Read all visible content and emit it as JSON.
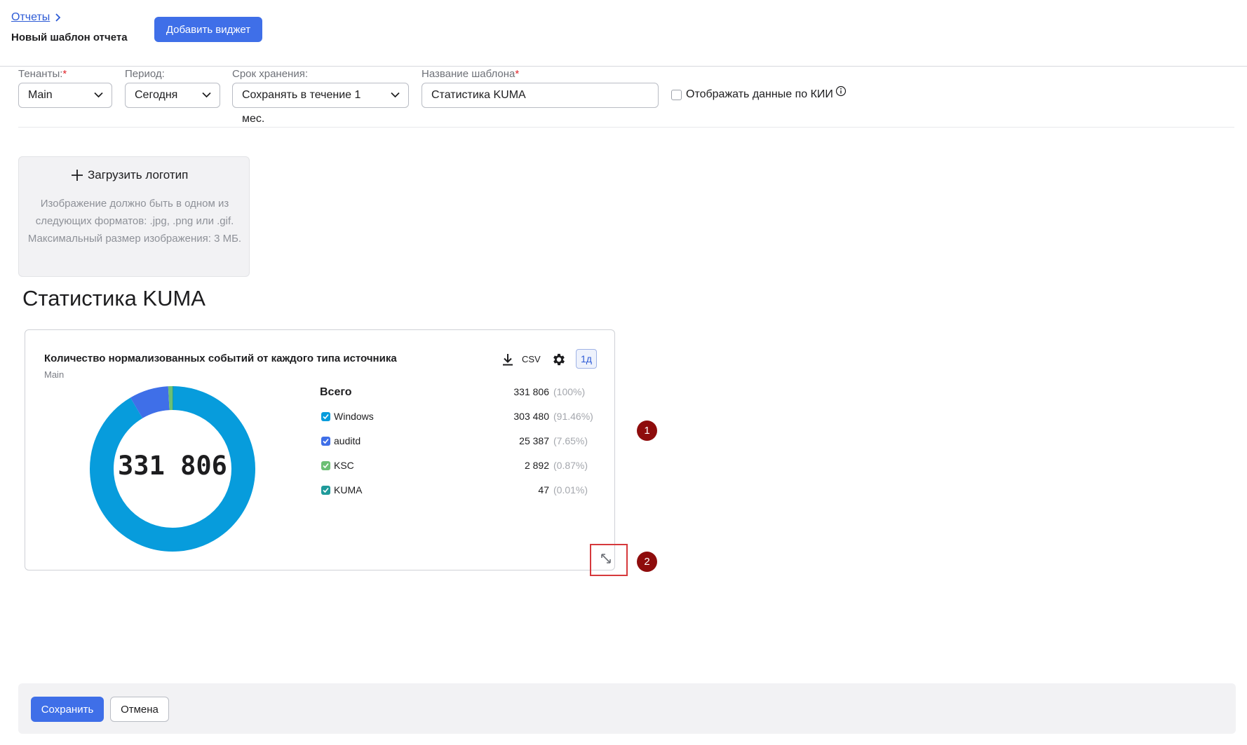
{
  "breadcrumb": {
    "parent": "Отчеты"
  },
  "page_title": "Новый шаблон отчета",
  "toolbar": {
    "add_widget": "Добавить виджет"
  },
  "filters": {
    "tenants": {
      "label": "Тенанты:",
      "required_mark": "*",
      "value": "Main"
    },
    "period": {
      "label": "Период:",
      "value": "Сегодня"
    },
    "retention": {
      "label": "Срок хранения:",
      "value": "Сохранять в течение 1 мес."
    },
    "template_name": {
      "label": "Название шаблона",
      "required_mark": "*",
      "value": "Статистика KUMA"
    },
    "kii_checkbox": {
      "label": "Отображать данные по КИИ",
      "checked": false
    }
  },
  "logo_upload": {
    "button": "Загрузить логотип",
    "hint": "Изображение должно быть в одном из следующих форматов: .jpg, .png или .gif. Максимальный размер изображения: 3 МБ."
  },
  "report_title": "Статистика KUMA",
  "widget": {
    "title": "Количество нормализованных событий от каждого типа источника",
    "subtitle": "Main",
    "csv_label": "CSV",
    "period_button": "1д",
    "total_label": "Всего",
    "total_value": "331 806",
    "total_pct": "(100%)",
    "center_total": "331 806",
    "chart_data": {
      "type": "pie",
      "variant": "donut",
      "categories": [
        "Windows",
        "auditd",
        "KSC",
        "KUMA"
      ],
      "values": [
        303480,
        25387,
        2892,
        47
      ],
      "percentages": [
        "91.46%",
        "7.65%",
        "0.87%",
        "0.01%"
      ],
      "colors": [
        "#079cdc",
        "#3f6fe8",
        "#6cbf74",
        "#1f9a9a"
      ],
      "total": 331806
    },
    "legend": [
      {
        "name": "Windows",
        "value": "303 480",
        "pct": "(91.46%)",
        "color": "#079cdc"
      },
      {
        "name": "auditd",
        "value": "25 387",
        "pct": "(7.65%)",
        "color": "#3f6fe8"
      },
      {
        "name": "KSC",
        "value": "2 892",
        "pct": "(0.87%)",
        "color": "#6cbf74"
      },
      {
        "name": "KUMA",
        "value": "47",
        "pct": "(0.01%)",
        "color": "#1f9a9a"
      }
    ]
  },
  "annotations": {
    "badge1": "1",
    "badge2": "2"
  },
  "footer": {
    "save": "Сохранить",
    "cancel": "Отмена"
  },
  "icons": {
    "crumb": "chevron-right-icon",
    "select": "chevron-down-icon",
    "info": "info-icon",
    "plus": "plus-icon",
    "download": "download-icon",
    "gear": "gear-icon",
    "resize": "resize-icon"
  }
}
